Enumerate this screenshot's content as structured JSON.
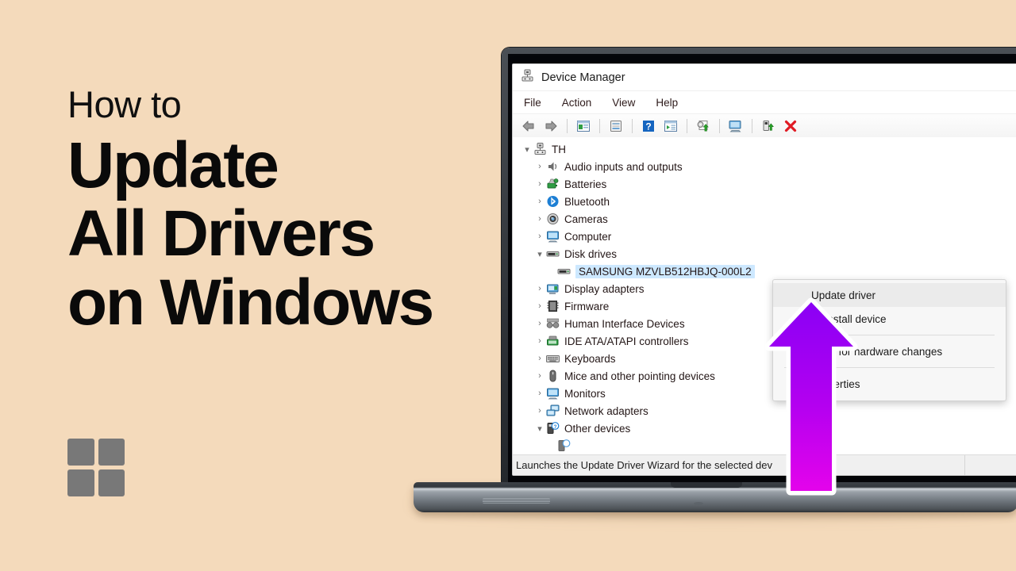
{
  "promo": {
    "kicker": "How to",
    "line1": "Update",
    "line2": "All Drivers",
    "line3": "on Windows",
    "logo_icon": "windows-logo-icon",
    "background_color": "#F4DABB",
    "text_color": "#0A0A0A",
    "logo_color": "#787878"
  },
  "window": {
    "title": "Device Manager",
    "title_icon": "device-manager-icon",
    "menubar": [
      "File",
      "Action",
      "View",
      "Help"
    ],
    "toolbar": [
      {
        "name": "back-button",
        "glyph": "back-arrow-icon"
      },
      {
        "name": "forward-button",
        "glyph": "forward-arrow-icon"
      },
      {
        "name": "separator-1",
        "glyph": "separator"
      },
      {
        "name": "show-hide-console-tree-button",
        "glyph": "console-tree-icon"
      },
      {
        "name": "separator-2",
        "glyph": "separator"
      },
      {
        "name": "properties-button",
        "glyph": "properties-icon"
      },
      {
        "name": "separator-3",
        "glyph": "separator"
      },
      {
        "name": "help-button",
        "glyph": "help-icon"
      },
      {
        "name": "show-hide-action-pane-button",
        "glyph": "action-pane-icon"
      },
      {
        "name": "separator-4",
        "glyph": "separator"
      },
      {
        "name": "update-driver-button",
        "glyph": "update-driver-icon"
      },
      {
        "name": "separator-5",
        "glyph": "separator"
      },
      {
        "name": "scan-hardware-changes-button",
        "glyph": "scan-hardware-icon"
      },
      {
        "name": "separator-6",
        "glyph": "separator"
      },
      {
        "name": "enable-device-button",
        "glyph": "enable-device-icon"
      },
      {
        "name": "uninstall-device-button",
        "glyph": "red-x-icon"
      }
    ],
    "status_text": "Launches the Update Driver Wizard for the selected dev"
  },
  "tree": [
    {
      "label": "TH",
      "level": 0,
      "state": "expanded",
      "icon": "computer-root-icon",
      "selected": false
    },
    {
      "label": "Audio inputs and outputs",
      "level": 1,
      "state": "collapsed",
      "icon": "speaker-icon",
      "selected": false
    },
    {
      "label": "Batteries",
      "level": 1,
      "state": "collapsed",
      "icon": "battery-icon",
      "selected": false
    },
    {
      "label": "Bluetooth",
      "level": 1,
      "state": "collapsed",
      "icon": "bluetooth-icon",
      "selected": false
    },
    {
      "label": "Cameras",
      "level": 1,
      "state": "collapsed",
      "icon": "camera-icon",
      "selected": false
    },
    {
      "label": "Computer",
      "level": 1,
      "state": "collapsed",
      "icon": "monitor-icon",
      "selected": false
    },
    {
      "label": "Disk drives",
      "level": 1,
      "state": "expanded",
      "icon": "disk-drive-icon",
      "selected": false
    },
    {
      "label": "SAMSUNG MZVLB512HBJQ-000L2",
      "level": 2,
      "state": "leaf",
      "icon": "disk-drive-icon",
      "selected": true
    },
    {
      "label": "Display adapters",
      "level": 1,
      "state": "collapsed",
      "icon": "display-adapter-icon",
      "selected": false
    },
    {
      "label": "Firmware",
      "level": 1,
      "state": "collapsed",
      "icon": "firmware-icon",
      "selected": false
    },
    {
      "label": "Human Interface Devices",
      "level": 1,
      "state": "collapsed",
      "icon": "hid-icon",
      "selected": false
    },
    {
      "label": "IDE ATA/ATAPI controllers",
      "level": 1,
      "state": "collapsed",
      "icon": "ide-controller-icon",
      "selected": false
    },
    {
      "label": "Keyboards",
      "level": 1,
      "state": "collapsed",
      "icon": "keyboard-icon",
      "selected": false
    },
    {
      "label": "Mice and other pointing devices",
      "level": 1,
      "state": "collapsed",
      "icon": "mouse-icon",
      "selected": false
    },
    {
      "label": "Monitors",
      "level": 1,
      "state": "collapsed",
      "icon": "monitor-icon",
      "selected": false
    },
    {
      "label": "Network adapters",
      "level": 1,
      "state": "collapsed",
      "icon": "network-adapter-icon",
      "selected": false
    },
    {
      "label": "Other devices",
      "level": 1,
      "state": "expanded",
      "icon": "unknown-device-icon",
      "selected": false
    }
  ],
  "context_menu": {
    "items": [
      {
        "label": "Update driver",
        "highlighted": true,
        "separator_after": false
      },
      {
        "label": "Uninstall device",
        "highlighted": false,
        "separator_after": true
      },
      {
        "label": "Scan for hardware changes",
        "highlighted": false,
        "separator_after": true
      },
      {
        "label": "Properties",
        "highlighted": false,
        "separator_after": false
      }
    ]
  },
  "annotation": {
    "arrow_icon": "up-arrow-callout-icon",
    "gradient_top": "#8A00F5",
    "gradient_bottom": "#E403EB",
    "outline_color": "#FFFFFF"
  },
  "selection_color": "#CDE8FF"
}
